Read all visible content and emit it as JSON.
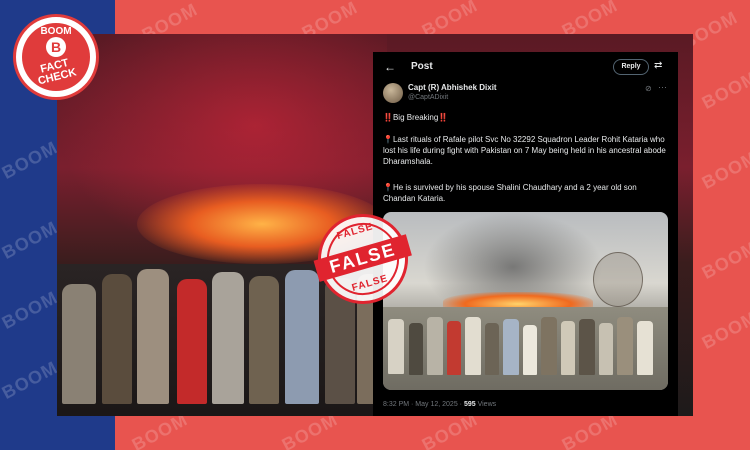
{
  "brand": {
    "logo_top": "BOOM",
    "logo_letter": "B",
    "logo_sub_line1": "FACT",
    "logo_sub_line2": "CHECK",
    "watermark": "BOOM",
    "colors": {
      "red": "#e8544f",
      "blue": "#1f3a8a",
      "stamp_red": "#e0242f"
    }
  },
  "stamp": {
    "top": "FALSE",
    "main": "FALSE",
    "bottom": "FALSE"
  },
  "tweet": {
    "header_title": "Post",
    "back_icon": "arrow-left-icon",
    "reply_label": "Reply",
    "author_name": "Capt (R) Abhishek Dixit",
    "author_handle": "@CaptADixit",
    "para1_mark": "‼️",
    "para1_text": "Big Breaking",
    "para2_pin": "📍",
    "para2_text": "Last rituals of Rafale pilot Svc No 32292 Squadron Leader Rohit Kataria who lost his life during fight with Pakistan on 7 May being held in his ancestral abode Dharamshala.",
    "para3_pin": "📍",
    "para3_text": "He is survived by his spouse Shalini Chaudhary and a 2 year old son Chandan Kataria.",
    "timestamp": "8:32 PM · May 12, 2025 ·",
    "views_count": "595",
    "views_label": "Views"
  }
}
